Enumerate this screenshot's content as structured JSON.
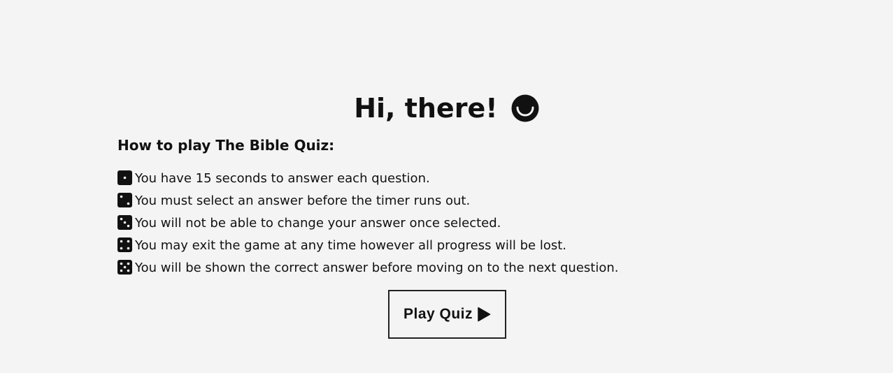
{
  "header": {
    "greeting": "Hi, there!",
    "greeting_icon": "smile-icon"
  },
  "instructions": {
    "title": "How to play The Bible Quiz:",
    "rules": [
      {
        "icon": "die-one-icon",
        "text": "You have 15 seconds to answer each question."
      },
      {
        "icon": "die-two-icon",
        "text": "You must select an answer before the timer runs out."
      },
      {
        "icon": "die-three-icon",
        "text": "You will not be able to change your answer once selected."
      },
      {
        "icon": "die-four-icon",
        "text": "You may exit the game at any time however all progress will be lost."
      },
      {
        "icon": "die-five-icon",
        "text": "You will be shown the correct answer before moving on to the next question."
      }
    ]
  },
  "actions": {
    "play_label": "Play Quiz",
    "play_icon": "play-icon"
  },
  "colors": {
    "background": "#f4f4f4",
    "text": "#111111",
    "button_border": "#222222"
  }
}
